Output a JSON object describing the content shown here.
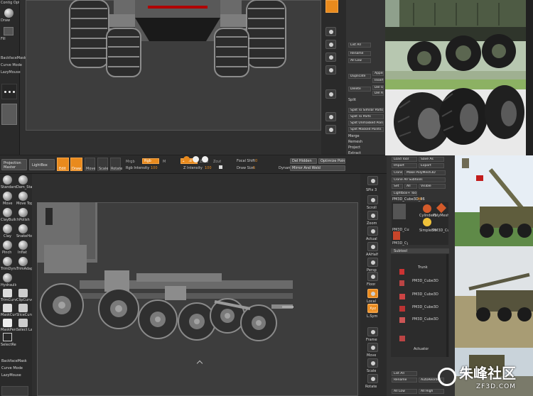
{
  "top_left_tray": {
    "items": [
      "Contig Options",
      "Draw",
      "Fill",
      "BackfaceMask",
      "Curve Mode",
      "LazyMouse"
    ]
  },
  "top_right_palette": {
    "labels": [
      "List All",
      "Rename",
      "All Low",
      "Duplicate",
      "Delete",
      "Split",
      "Split To Similar Parts",
      "Split To Parts",
      "Split Unmasked Points",
      "Split Masked Points",
      "Merge",
      "Remesh",
      "Project",
      "Extract"
    ],
    "right_col": [
      "Append",
      "Insert",
      "Del Oth",
      "Del All"
    ]
  },
  "top_shelf": {
    "projection_master": "Projection Master",
    "lightbox": "LightBox",
    "tools": [
      "Edit",
      "Draw",
      "Move",
      "Scale",
      "Rotate"
    ],
    "mrgb": "Mrgb",
    "rgb": "Rgb",
    "m": "M",
    "zadd": "Zadd",
    "zsub": "Zsub",
    "zcut": "Zcut",
    "rgb_intensity_label": "Rgb Intensity",
    "rgb_intensity_value": "100",
    "z_intensity_label": "Z Intensity",
    "z_intensity_value": "100",
    "focal_shift_label": "Focal Shift",
    "focal_shift_value": "0",
    "draw_size_label": "Draw Size",
    "draw_size_value": "5",
    "dynamic": "Dynamic",
    "del_hidden": "Del Hidden",
    "optimize_points": "Optimize Points",
    "mirror_and_weld": "Mirror And Weld"
  },
  "left_tray": {
    "brushes": [
      "Standard",
      "Dam_Stan",
      "Move",
      "Move Topolo",
      "ClayBuildup",
      "hPolish",
      "Clay",
      "SnakeHook",
      "Pinch",
      "Inflat",
      "TrimDyna",
      "TrimAdap"
    ],
    "lower_brushes": [
      "Hydraulic",
      "TrimCurve",
      "ClipCurve",
      "MaskCurve",
      "SliceCurve",
      "MaskPen",
      "Select Lasso",
      "SelectRect"
    ],
    "bottom": [
      "BackfaceMask",
      "Curve Mode",
      "LazyMouse"
    ]
  },
  "right_shelf": {
    "buttons": [
      "SPix 3",
      "Scroll",
      "Zoom",
      "Actual",
      "AAHalf",
      "Persp",
      "Floor",
      "Local",
      "L.Sym",
      "Xyz",
      "Frame",
      "Move",
      "Scale",
      "Rotate"
    ]
  },
  "tool_palette": {
    "load_tool": "Load Tool",
    "save_as": "Save As",
    "import": "Import",
    "export": "Export",
    "clone": "Clone",
    "make_polymesh": "Make PolyMesh3D",
    "clone_all_subtools": "Clone All Subtools",
    "set": "Set",
    "all": "All",
    "visible": "Visible",
    "lightbox_tools": "Lightbox+ Tools",
    "current_tool": "PM3D_Cube3D_46",
    "thumbs": [
      "PM3D_Cube3D",
      "Cylinder3D",
      "PolyMesh3D",
      "SimpleBrus",
      "PM3D_Cub",
      "PM3D_Cy"
    ],
    "thumb_count": "46",
    "subtool_header": "Subtool",
    "subtool_items": [
      "Trunk",
      "PM3D_Cube3D",
      "PM3D_Cube3D",
      "PM3D_Cube3D",
      "PM3D_Cube3D",
      "Actuator"
    ],
    "list_all": "List All",
    "rename": "Rename",
    "autoreorder": "AutoReorder",
    "all_low": "All Low",
    "all_high": "All High"
  },
  "watermark": {
    "cn": "朱峰社区",
    "url": "ZF3D.COM"
  },
  "colors": {
    "accent": "#e98a1d",
    "ui": "#3a3a3a",
    "viewport": "#3b3b3b"
  }
}
